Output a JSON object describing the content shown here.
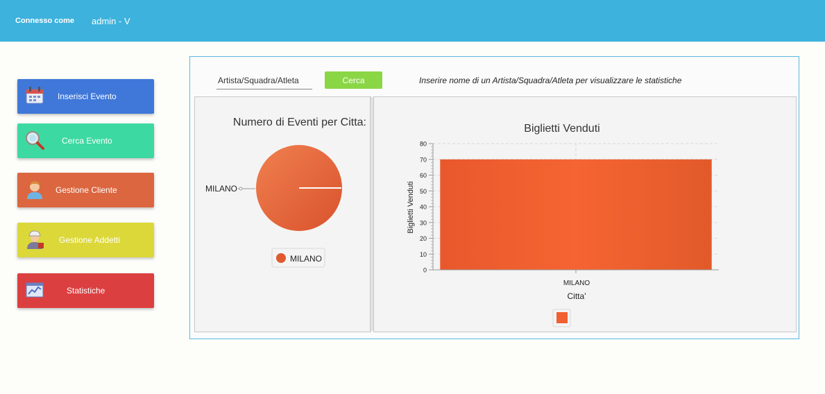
{
  "header": {
    "connected_label": "Connesso come",
    "user": "admin - V"
  },
  "sidebar": {
    "items": [
      {
        "label": "Inserisci Evento",
        "color": "#3f78d9",
        "icon": "calendar-icon"
      },
      {
        "label": "Cerca Evento",
        "color": "#3dd9a2",
        "icon": "magnifier-icon"
      },
      {
        "label": "Gestione Cliente",
        "color": "#db6640",
        "icon": "customer-icon"
      },
      {
        "label": "Gestione Addetti",
        "color": "#dcd83a",
        "icon": "worker-icon"
      },
      {
        "label": "Statistiche",
        "color": "#dc3f40",
        "icon": "statistics-icon"
      }
    ]
  },
  "search": {
    "placeholder": "Artista/Squadra/Atleta",
    "button_label": "Cerca",
    "hint": "Inserire nome di un Artista/Squadra/Atleta per visualizzare le statistiche"
  },
  "chart_data": [
    {
      "type": "pie",
      "title": "Numero di Eventi per Citta:",
      "slices": [
        {
          "label": "MILANO",
          "value": 1
        }
      ],
      "legend": [
        "MILANO"
      ],
      "legend_placement": "bottom",
      "color": "#e8603a"
    },
    {
      "type": "bar",
      "title": "Biglietti Venduti",
      "categories": [
        "MILANO"
      ],
      "values": [
        70
      ],
      "xlabel": "Citta'",
      "ylabel": "Biglietti Venduti",
      "ylim": [
        0,
        80
      ],
      "yticks": [
        0,
        10,
        20,
        30,
        40,
        50,
        60,
        70,
        80
      ],
      "grid": true,
      "legend_placement": "bottom",
      "color": "#f06030"
    }
  ]
}
